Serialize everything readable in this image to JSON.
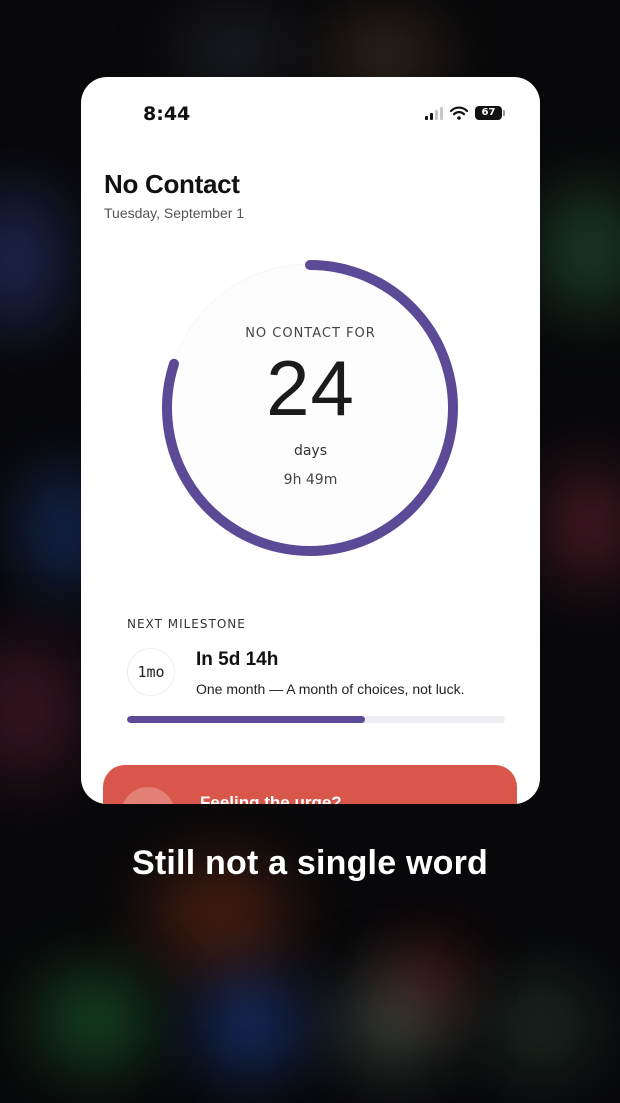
{
  "status_bar": {
    "time": "8:44",
    "battery": "67"
  },
  "header": {
    "title": "No Contact",
    "date": "Tuesday, September 1"
  },
  "counter": {
    "caption": "NO CONTACT FOR",
    "number": "24",
    "unit": "days",
    "sub": "9h 49m",
    "progress": 0.8,
    "color": "#5b4a96"
  },
  "milestone": {
    "label": "NEXT MILESTONE",
    "badge": "1mo",
    "title": "In 5d 14h",
    "description": "One month — A month of choices, not luck.",
    "progress": 0.63
  },
  "urge_button": {
    "label": "Feeling the urge?",
    "color": "#d9564a"
  },
  "caption": "Still not a single word"
}
